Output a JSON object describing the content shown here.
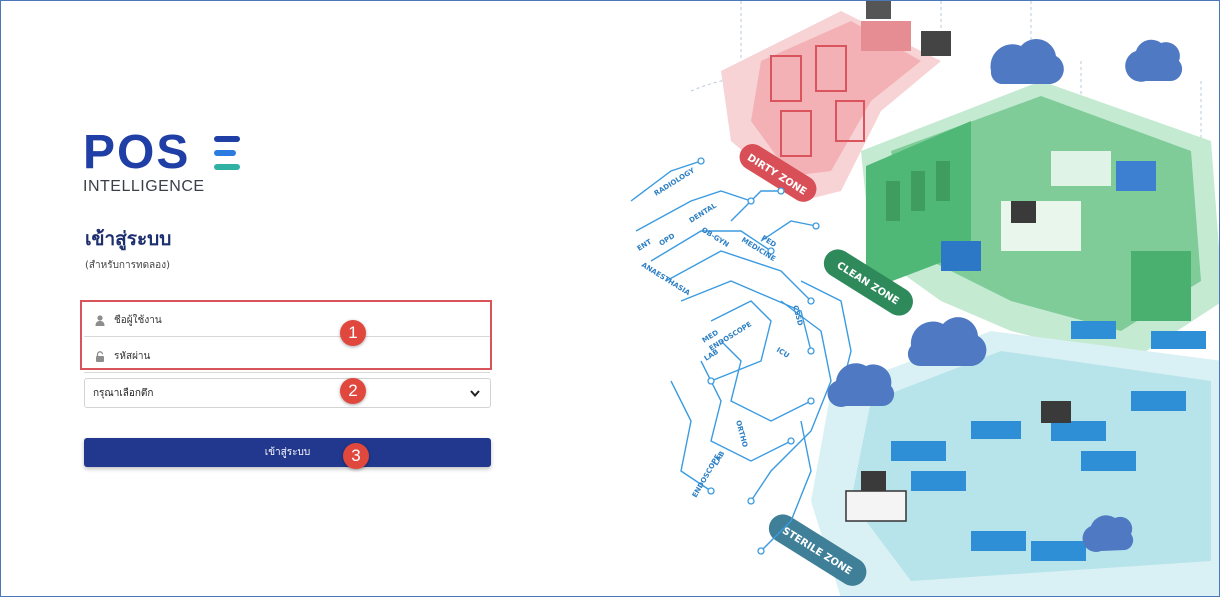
{
  "brand": {
    "logo_text": "POS",
    "logo_subtitle": "INTELLIGENCE",
    "colors": {
      "primary": "#1f3ea6",
      "accent_blue": "#2c7be0",
      "accent_teal": "#2fb1a3"
    }
  },
  "login": {
    "title": "เข้าสู่ระบบ",
    "subtitle": "(สำหรับการทดลอง)",
    "username_placeholder": "ชื่อผู้ใช้งาน",
    "password_placeholder": "รหัสผ่าน",
    "building_select_value": "กรุณาเลือกตึก",
    "submit_label": "เข้าสู่ระบบ",
    "button_color": "#21388e"
  },
  "annotations": {
    "badge_1": "1",
    "badge_2": "2",
    "badge_3": "3",
    "badge_color": "#e0483e"
  },
  "illustration": {
    "zones": [
      "DIRTY ZONE",
      "CLEAN ZONE",
      "STERILE ZONE"
    ],
    "departments": [
      "RADIOLOGY",
      "ENT",
      "OPD",
      "DENTAL",
      "ANAESTHASIA",
      "OB-GYN",
      "PED",
      "MEDICINE",
      "MED",
      "ENDOSCOPE",
      "CSSD",
      "LAB",
      "ICU",
      "ORTHO",
      "LAB",
      "ENDOSCOPE"
    ],
    "zone_colors": {
      "dirty": "#e9868b",
      "clean": "#49b679",
      "sterile": "#8fd6e0",
      "cloud": "#4f79c2"
    }
  }
}
